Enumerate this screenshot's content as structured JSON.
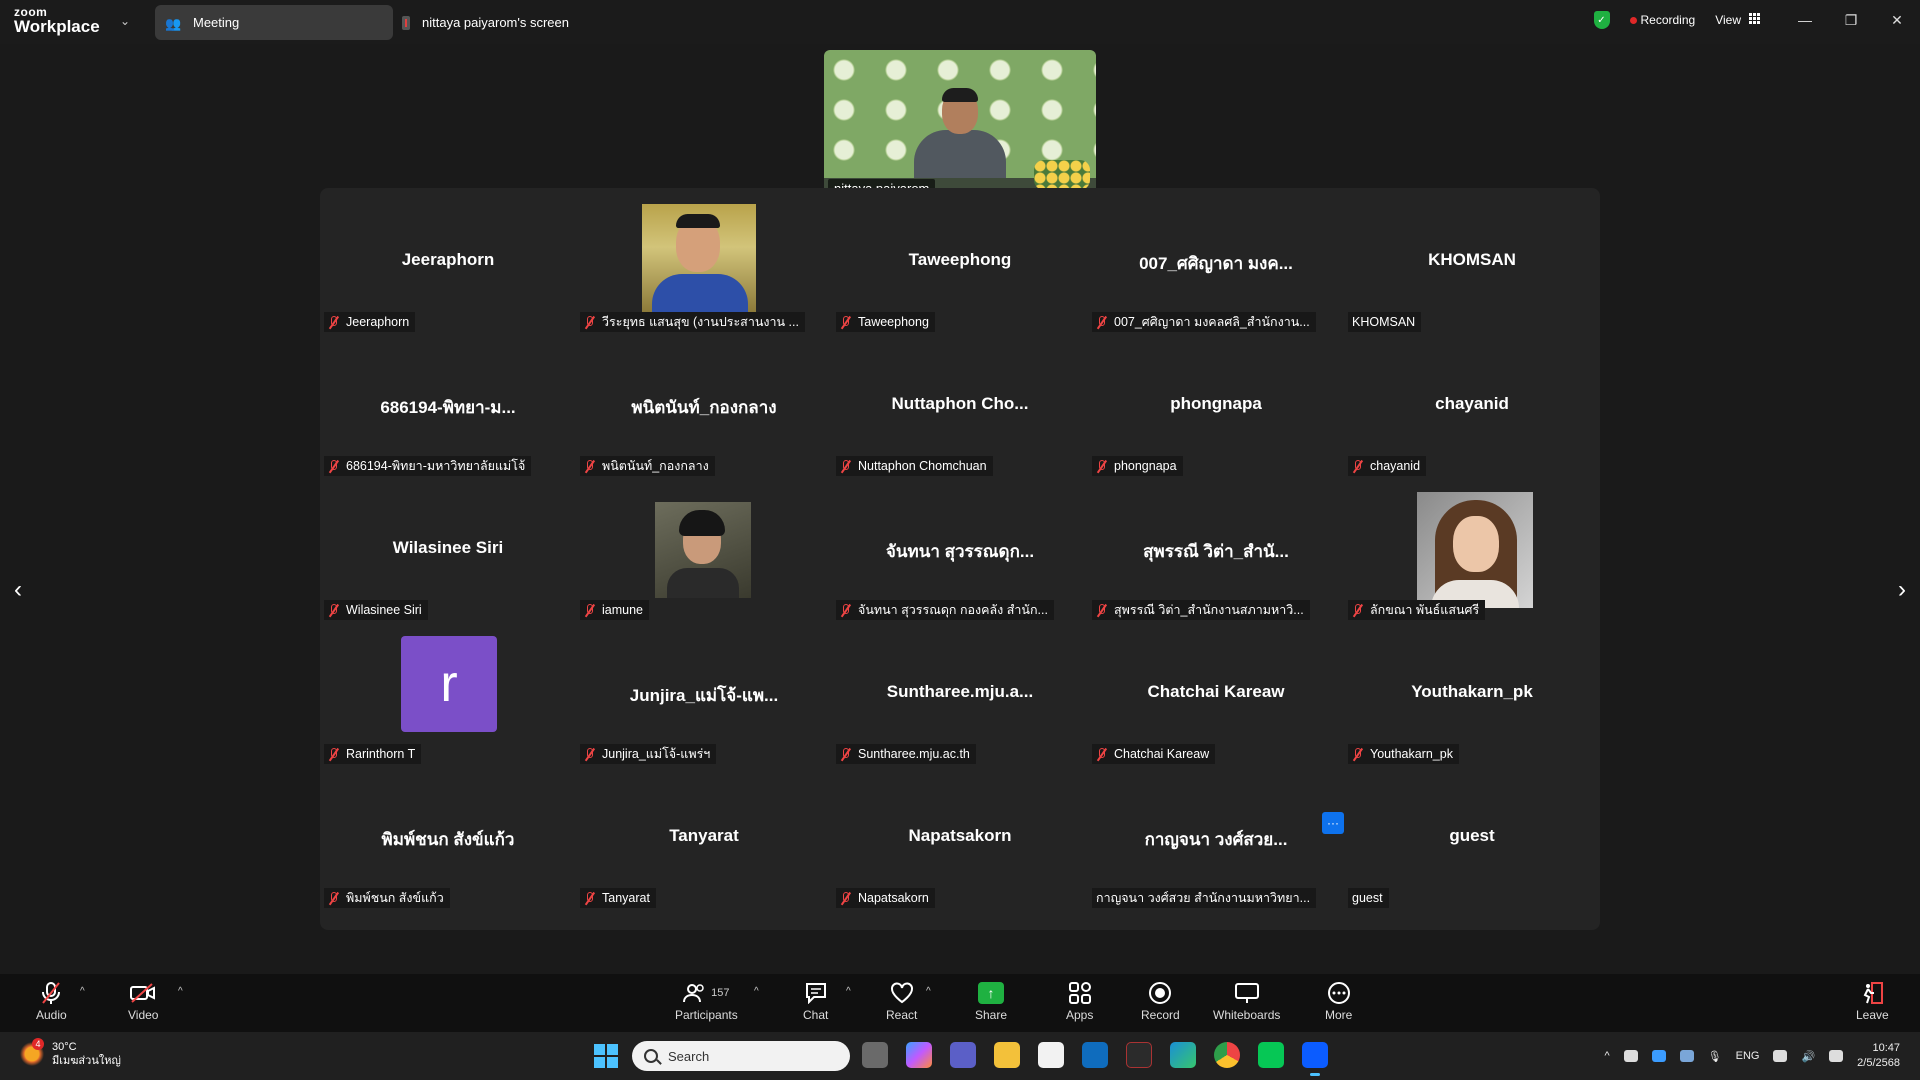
{
  "app": {
    "brand_top": "zoom",
    "brand_bottom": "Workplace",
    "tab_meeting": "Meeting",
    "tab_screen": "nittaya paiyarom's screen",
    "recording": "Recording",
    "view": "View"
  },
  "speaker": {
    "name": "nittaya paiyarom"
  },
  "tiles": [
    {
      "center": "Jeeraphorn",
      "label": "Jeeraphorn",
      "muted": true
    },
    {
      "center": "",
      "label": "วีระยุทธ แสนสุข (งานประสานงาน ...",
      "muted": true,
      "photo": "man"
    },
    {
      "center": "Taweephong",
      "label": "Taweephong",
      "muted": true
    },
    {
      "center": "007_ศศิญาดา มงค...",
      "label": "007_ศศิญาดา มงคลศลิ_สำนักงาน...",
      "muted": true
    },
    {
      "center": "KHOMSAN",
      "label": "KHOMSAN",
      "muted": false
    },
    {
      "center": "686194-พิทยา-ม...",
      "label": "686194-พิทยา-มหาวิทยาลัยแม่โจ้",
      "muted": true
    },
    {
      "center": "พนิตนันท์_กองกลาง",
      "label": "พนิตนันท์_กองกลาง",
      "muted": true
    },
    {
      "center": "Nuttaphon  Cho...",
      "label": "Nuttaphon Chomchuan",
      "muted": true
    },
    {
      "center": "phongnapa",
      "label": "phongnapa",
      "muted": true
    },
    {
      "center": "chayanid",
      "label": "chayanid",
      "muted": true
    },
    {
      "center": "Wilasinee Siri",
      "label": "Wilasinee Siri",
      "muted": true
    },
    {
      "center": "",
      "label": "iamune",
      "muted": true,
      "photo": "iam"
    },
    {
      "center": "จันทนา สุวรรณดุก...",
      "label": "จันทนา สุวรรณดุก กองคลัง สำนัก...",
      "muted": true
    },
    {
      "center": "สุพรรณี วิต่า_สำนั...",
      "label": "สุพรรณี วิต่า_สำนักงานสภามหาวิ...",
      "muted": true
    },
    {
      "center": "",
      "label": "ลักขณา พันธ์แสนศรี",
      "muted": true,
      "photo": "woman"
    },
    {
      "center": "",
      "label": "Rarinthorn T",
      "muted": true,
      "avatar": "r"
    },
    {
      "center": "Junjira_แม่โจ้-แพ...",
      "label": "Junjira_แม่โจ้-แพร่ฯ",
      "muted": true
    },
    {
      "center": "Suntharee.mju.a...",
      "label": "Suntharee.mju.ac.th",
      "muted": true
    },
    {
      "center": "Chatchai Kareaw",
      "label": "Chatchai Kareaw",
      "muted": true
    },
    {
      "center": "Youthakarn_pk",
      "label": "Youthakarn_pk",
      "muted": true
    },
    {
      "center": "พิมพ์ชนก สังข์แก้ว",
      "label": "พิมพ์ชนก สังข์แก้ว",
      "muted": true
    },
    {
      "center": "Tanyarat",
      "label": "Tanyarat",
      "muted": true
    },
    {
      "center": "Napatsakorn",
      "label": "Napatsakorn",
      "muted": true
    },
    {
      "center": "กาญจนา วงศ์สวย...",
      "label": "กาญจนา วงศ์สวย สำนักงานมหาวิทยา...",
      "muted": false
    },
    {
      "center": "guest",
      "label": "guest",
      "muted": false
    }
  ],
  "toolbar": {
    "audio": "Audio",
    "video": "Video",
    "participants": "Participants",
    "participants_count": "157",
    "chat": "Chat",
    "react": "React",
    "share": "Share",
    "apps": "Apps",
    "record": "Record",
    "whiteboards": "Whiteboards",
    "more": "More",
    "leave": "Leave"
  },
  "taskbar": {
    "weather_temp": "30°C",
    "weather_desc": "มีเมฆส่วนใหญ่",
    "weather_badge": "4",
    "search_placeholder": "Search",
    "lang": "ENG",
    "time": "10:47",
    "date": "2/5/2568"
  },
  "colors": {
    "accent": "#0e72ed",
    "share_green": "#1fb141",
    "mute_red": "#ee4444",
    "avatar_purple": "#7b4fc8"
  }
}
